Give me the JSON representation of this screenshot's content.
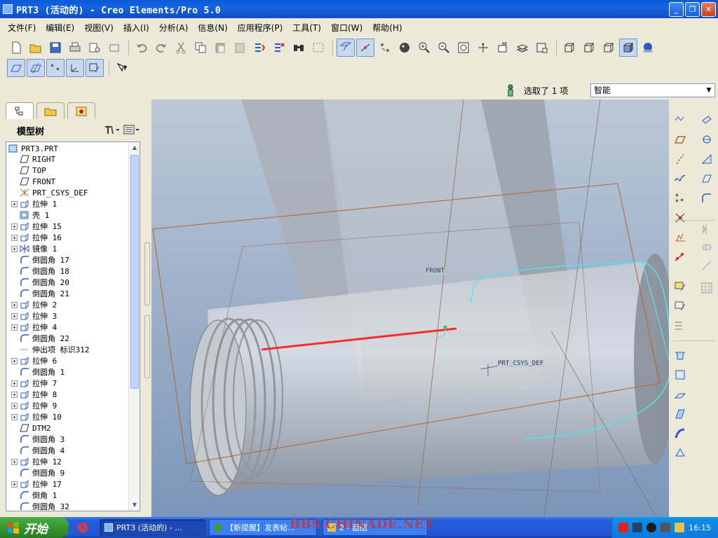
{
  "window": {
    "title": "PRT3 (活动的) - Creo Elements/Pro 5.0",
    "buttons": [
      "minimize",
      "restore",
      "close"
    ]
  },
  "menu": [
    "文件(F)",
    "编辑(E)",
    "视图(V)",
    "插入(I)",
    "分析(A)",
    "信息(N)",
    "应用程序(P)",
    "工具(T)",
    "窗口(W)",
    "帮助(H)"
  ],
  "selection": {
    "status_text": "选取了 1 项",
    "filter_value": "智能"
  },
  "model_tree": {
    "title": "模型树",
    "items": [
      {
        "label": "PRT3.PRT",
        "icon": "part-icon",
        "expandable": false,
        "root": true
      },
      {
        "label": "RIGHT",
        "icon": "datum-plane-icon",
        "expandable": false
      },
      {
        "label": "TOP",
        "icon": "datum-plane-icon",
        "expandable": false
      },
      {
        "label": "FRONT",
        "icon": "datum-plane-icon",
        "expandable": false
      },
      {
        "label": "PRT_CSYS_DEF",
        "icon": "csys-icon",
        "expandable": false
      },
      {
        "label": "拉伸 1",
        "icon": "extrude-icon",
        "expandable": true
      },
      {
        "label": "壳 1",
        "icon": "shell-icon",
        "expandable": false
      },
      {
        "label": "拉伸 15",
        "icon": "extrude-icon",
        "expandable": true
      },
      {
        "label": "拉伸 16",
        "icon": "extrude-icon",
        "expandable": true
      },
      {
        "label": "镜像 1",
        "icon": "mirror-icon",
        "expandable": true
      },
      {
        "label": "倒圆角 17",
        "icon": "round-icon",
        "expandable": false
      },
      {
        "label": "倒圆角 18",
        "icon": "round-icon",
        "expandable": false
      },
      {
        "label": "倒圆角 20",
        "icon": "round-icon",
        "expandable": false
      },
      {
        "label": "倒圆角 21",
        "icon": "round-icon",
        "expandable": false
      },
      {
        "label": "拉伸 2",
        "icon": "extrude-icon",
        "expandable": true
      },
      {
        "label": "拉伸 3",
        "icon": "extrude-icon",
        "expandable": true
      },
      {
        "label": "拉伸 4",
        "icon": "extrude-icon",
        "expandable": true
      },
      {
        "label": "倒圆角 22",
        "icon": "round-icon",
        "expandable": false
      },
      {
        "label": "伸出项 标识312",
        "icon": "protrusion-icon",
        "expandable": false
      },
      {
        "label": "拉伸 6",
        "icon": "extrude-icon",
        "expandable": true
      },
      {
        "label": "倒圆角 1",
        "icon": "round-icon",
        "expandable": false
      },
      {
        "label": "拉伸 7",
        "icon": "extrude-icon",
        "expandable": true
      },
      {
        "label": "拉伸 8",
        "icon": "extrude-icon",
        "expandable": true
      },
      {
        "label": "拉伸 9",
        "icon": "extrude-icon",
        "expandable": true
      },
      {
        "label": "拉伸 10",
        "icon": "extrude-icon",
        "expandable": true
      },
      {
        "label": "DTM2",
        "icon": "datum-plane-icon",
        "expandable": false
      },
      {
        "label": "倒圆角 3",
        "icon": "round-icon",
        "expandable": false
      },
      {
        "label": "倒圆角 4",
        "icon": "round-icon",
        "expandable": false
      },
      {
        "label": "拉伸 12",
        "icon": "extrude-icon",
        "expandable": true
      },
      {
        "label": "倒圆角 9",
        "icon": "round-icon",
        "expandable": false
      },
      {
        "label": "拉伸 17",
        "icon": "extrude-icon",
        "expandable": true
      },
      {
        "label": "倒角 1",
        "icon": "chamfer-icon",
        "expandable": false
      },
      {
        "label": "倒圆角 32",
        "icon": "round-icon",
        "expandable": false
      }
    ]
  },
  "viewport": {
    "labels": {
      "front": "FRONT",
      "csys": "PRT_CSYS_DEF"
    },
    "colors": {
      "bg_top": "#b8c4d4",
      "bg_bottom": "#7d96b8",
      "datum_edge": "#b5652a",
      "selected_edge": "#4fe6f0",
      "axis_highlight": "#ff2a2a"
    }
  },
  "taskbar": {
    "start_label": "开始",
    "tasks": [
      {
        "label": "PRT3 (活动的) - ...",
        "icon": "creo-icon",
        "active": true
      },
      {
        "label": "【新提醒】发表帖...",
        "icon": "browser-icon",
        "active": false
      },
      {
        "label": "2 - 画图",
        "icon": "paint-icon",
        "active": false
      }
    ],
    "clock": "16:15",
    "watermark": "BBS.CHINADE.NET"
  }
}
